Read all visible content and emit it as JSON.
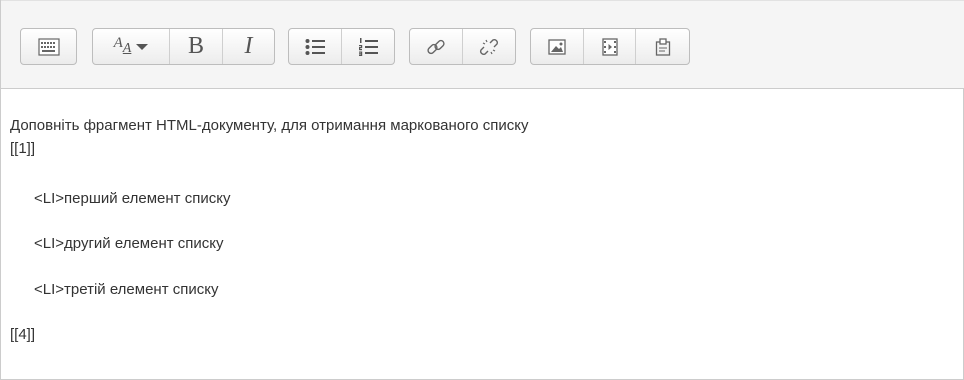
{
  "toolbar": {
    "groups": [
      {
        "name": "show-more",
        "buttons": [
          "show-more-buttons-icon"
        ]
      },
      {
        "name": "font",
        "buttons": [
          "font-style-icon",
          "bold-icon",
          "italic-icon"
        ]
      },
      {
        "name": "lists",
        "buttons": [
          "unordered-list-icon",
          "ordered-list-icon"
        ]
      },
      {
        "name": "links",
        "buttons": [
          "link-icon",
          "unlink-icon"
        ]
      },
      {
        "name": "media",
        "buttons": [
          "image-icon",
          "media-icon",
          "manage-files-icon"
        ]
      }
    ],
    "labels": {
      "font_style": "A",
      "font_style_sub": "A",
      "bold": "B",
      "italic": "I"
    }
  },
  "content": {
    "intro": "Доповніть фрагмент HTML-документу, для отримання маркованого списку",
    "blank_1": "[[1]]",
    "items": [
      "<LI>перший елемент списку",
      "<LI>другий елемент списку",
      "<LI>третій елемент списку"
    ],
    "blank_4": "[[4]]"
  },
  "colors": {
    "toolbar_bg": "#f5f5f5",
    "border": "#cccccc",
    "text": "#333333",
    "icon": "#555555"
  }
}
